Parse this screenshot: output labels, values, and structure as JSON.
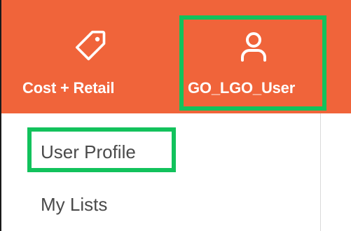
{
  "colors": {
    "accent": "#f0643a",
    "highlight": "#12c25c"
  },
  "nav": {
    "cost_retail": {
      "label": "Cost + Retail",
      "icon": "tag-icon"
    },
    "user": {
      "label": "GO_LGO_User",
      "icon": "user-icon"
    }
  },
  "user_menu": {
    "items": [
      {
        "label": "User Profile"
      },
      {
        "label": "My Lists"
      }
    ]
  }
}
